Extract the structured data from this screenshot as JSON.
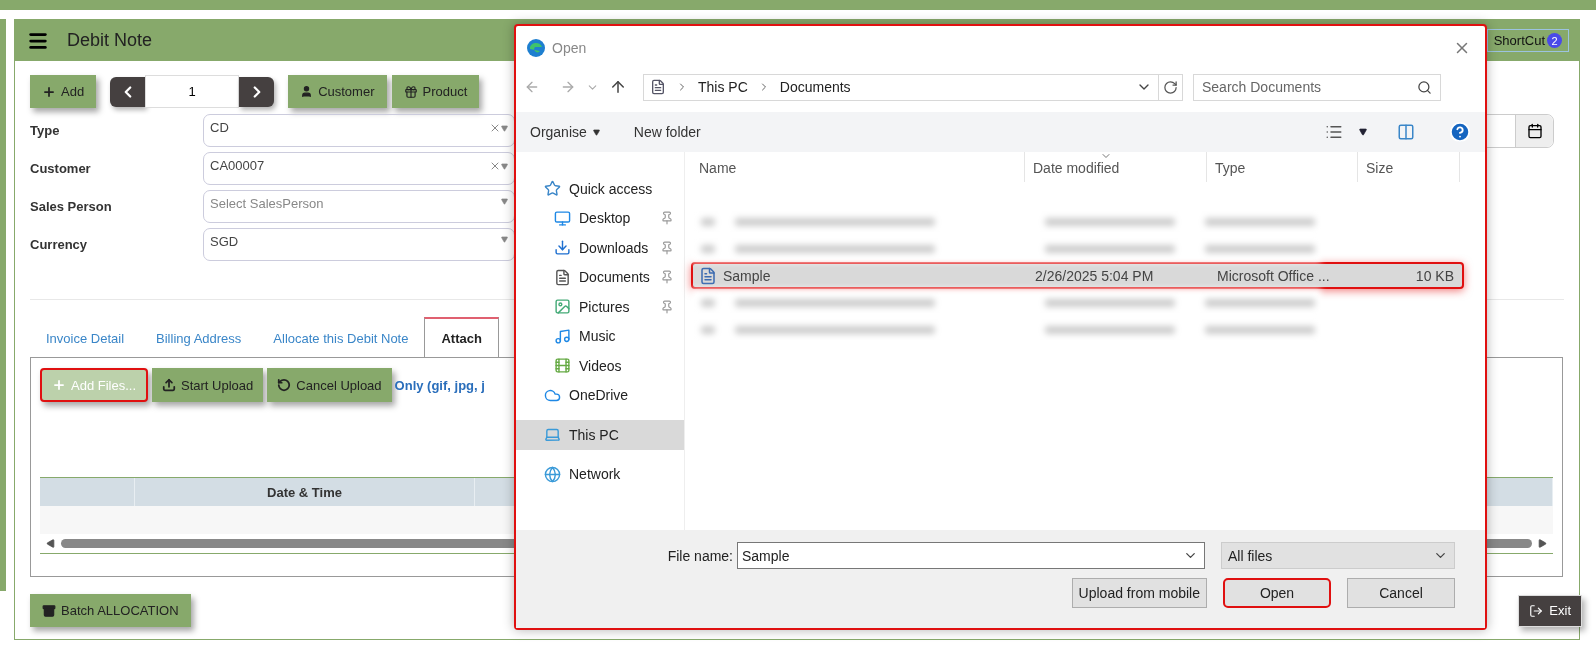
{
  "page": {
    "title": "Debit Note",
    "shortcut": {
      "label": "ShortCut",
      "badge": "2"
    },
    "toolbar": {
      "add": "Add",
      "record": "1",
      "customer": "Customer",
      "product": "Product"
    },
    "fields": [
      {
        "label": "Type",
        "value": "CD",
        "clearable": true
      },
      {
        "label": "Customer",
        "value": "CA00007",
        "clearable": true
      },
      {
        "label": "Sales Person",
        "placeholder": "Select SalesPerson",
        "clearable": false
      },
      {
        "label": "Currency",
        "value": "SGD",
        "clearable": false
      }
    ],
    "tabs": [
      {
        "label": "Invoice Detail",
        "selected": false
      },
      {
        "label": "Billing Address",
        "selected": false
      },
      {
        "label": "Allocate this Debit Note",
        "selected": false
      },
      {
        "label": "Attach",
        "selected": true
      }
    ],
    "upload": {
      "buttons": [
        {
          "kind": "add",
          "label": "Add Files...",
          "highlighted": true
        },
        {
          "kind": "start",
          "label": "Start Upload",
          "highlighted": false
        },
        {
          "kind": "cancel",
          "label": "Cancel Upload",
          "highlighted": false
        }
      ],
      "note": "Only (gif, jpg, j"
    },
    "table": {
      "columns": [
        "Date & Time"
      ]
    },
    "footer": {
      "batch": "Batch ALLOCATION",
      "exit": "Exit"
    }
  },
  "dialog": {
    "title": "Open",
    "path": [
      "This PC",
      "Documents"
    ],
    "search": {
      "placeholder": "Search Documents"
    },
    "organise": "Organise",
    "new_folder": "New folder",
    "nav": [
      {
        "kind": "quick",
        "label": "Quick access",
        "selected": false,
        "children": [
          {
            "kind": "desktop",
            "label": "Desktop",
            "pinned": true,
            "selected": false
          },
          {
            "kind": "downloads",
            "label": "Downloads",
            "pinned": true,
            "selected": false
          },
          {
            "kind": "documents",
            "label": "Documents",
            "pinned": true,
            "selected": false
          },
          {
            "kind": "pictures",
            "label": "Pictures",
            "pinned": true,
            "selected": false
          },
          {
            "kind": "music",
            "label": "Music",
            "pinned": false,
            "selected": false
          },
          {
            "kind": "videos",
            "label": "Videos",
            "pinned": false,
            "selected": false
          }
        ]
      },
      {
        "kind": "onedrive",
        "label": "OneDrive",
        "selected": false
      },
      {
        "kind": "pc",
        "label": "This PC",
        "selected": true
      },
      {
        "kind": "network",
        "label": "Network",
        "selected": false
      }
    ],
    "columns": [
      "Name",
      "Date modified",
      "Type",
      "Size"
    ],
    "files": [
      {
        "kind": "blurred",
        "selected": false
      },
      {
        "kind": "blurred",
        "selected": false
      },
      {
        "kind": "file",
        "name": "Sample",
        "modified": "2/26/2025 5:04 PM",
        "type": "Microsoft Office ...",
        "size": "10 KB",
        "selected": true,
        "highlighted": true
      },
      {
        "kind": "blurred",
        "selected": false
      },
      {
        "kind": "blurred",
        "selected": false
      }
    ],
    "file_name": {
      "label": "File name:",
      "value": "Sample"
    },
    "filter": "All files",
    "buttons": [
      {
        "label": "Upload from mobile",
        "highlighted": false
      },
      {
        "label": "Open",
        "highlighted": true
      },
      {
        "label": "Cancel",
        "highlighted": false
      }
    ]
  }
}
